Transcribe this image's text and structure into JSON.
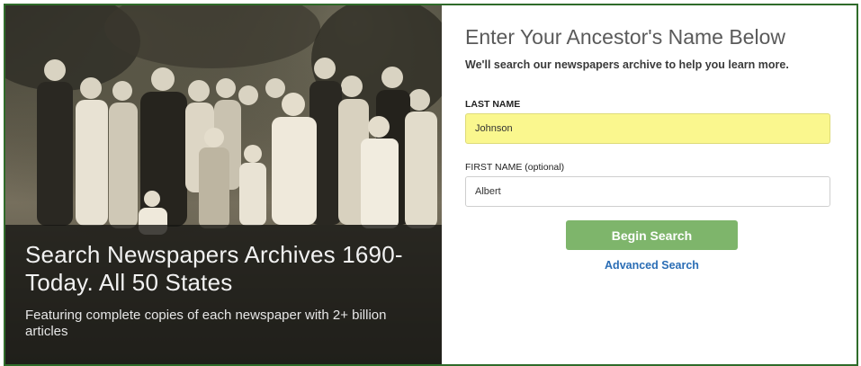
{
  "hero": {
    "title": "Search Newspapers Archives 1690-Today. All 50 States",
    "subtitle": "Featuring complete copies of each newspaper with 2+ billion articles"
  },
  "form": {
    "heading": "Enter Your Ancestor's Name Below",
    "subheading": "We'll search our newspapers archive to help you learn more.",
    "last_name_label": "LAST NAME",
    "last_name_value": "Johnson",
    "first_name_label": "FIRST NAME (optional)",
    "first_name_value": "Albert",
    "search_button": "Begin Search",
    "advanced_link": "Advanced Search"
  },
  "colors": {
    "frame_border": "#2f6b2a",
    "last_name_highlight": "#faf78e",
    "button": "#7eb56b",
    "link": "#2a6db5"
  }
}
